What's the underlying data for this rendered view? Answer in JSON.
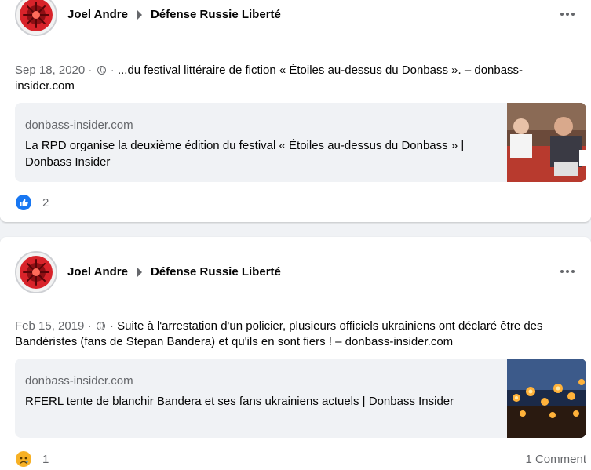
{
  "posts": [
    {
      "author": "Joel Andre",
      "group": "Défense Russie Liberté",
      "date": "Sep 18, 2020",
      "separator": "·",
      "separator2": "·",
      "text": "...du festival littéraire de fiction « Étoiles au-dessus du Donbass ». – donbass-insider.com",
      "link": {
        "domain": "donbass-insider.com",
        "title": "La RPD organise la deuxième édition du festival « Étoiles au-dessus du Donbass » | Donbass Insider"
      },
      "reaction_count": "2",
      "reaction_icon": "like-icon"
    },
    {
      "author": "Joel Andre",
      "group": "Défense Russie Liberté",
      "date": "Feb 15, 2019",
      "separator": "·",
      "separator2": "·",
      "text": "Suite à l'arrestation d'un policier, plusieurs officiels ukrainiens ont déclaré être des Bandéristes (fans de Stepan Bandera) et qu'ils en sont fiers ! – donbass-insider.com",
      "link": {
        "domain": "donbass-insider.com",
        "title": "RFERL tente de blanchir Bandera et ses fans ukrainiens actuels | Donbass Insider"
      },
      "reaction_count": "1",
      "reaction_icon": "sad-icon",
      "comments": "1 Comment"
    }
  ],
  "colors": {
    "background": "#f0f2f5",
    "card": "#ffffff",
    "meta_text": "#65676b",
    "like_blue": "#1877f2",
    "avatar_red": "#d8232a"
  }
}
